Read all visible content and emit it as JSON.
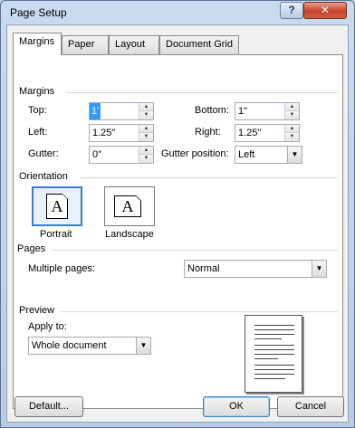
{
  "window": {
    "title": "Page Setup",
    "help_label": "?",
    "close_label": "✕"
  },
  "tabs": [
    {
      "label": "Margins",
      "active": true
    },
    {
      "label": "Paper",
      "active": false
    },
    {
      "label": "Layout",
      "active": false
    },
    {
      "label": "Document Grid",
      "active": false
    }
  ],
  "margins": {
    "section_title": "Margins",
    "top_label": "Top:",
    "top_value": "1\"",
    "bottom_label": "Bottom:",
    "bottom_value": "1\"",
    "left_label": "Left:",
    "left_value": "1.25\"",
    "right_label": "Right:",
    "right_value": "1.25\"",
    "gutter_label": "Gutter:",
    "gutter_value": "0\"",
    "gutter_position_label": "Gutter position:",
    "gutter_position_value": "Left"
  },
  "orientation": {
    "section_title": "Orientation",
    "portrait_label": "Portrait",
    "landscape_label": "Landscape",
    "icon_glyph": "A",
    "selected": "portrait"
  },
  "pages": {
    "section_title": "Pages",
    "multiple_pages_label": "Multiple pages:",
    "multiple_pages_value": "Normal"
  },
  "preview": {
    "section_title": "Preview",
    "apply_to_label": "Apply to:",
    "apply_to_value": "Whole document"
  },
  "buttons": {
    "default_label": "Default...",
    "ok_label": "OK",
    "cancel_label": "Cancel"
  }
}
